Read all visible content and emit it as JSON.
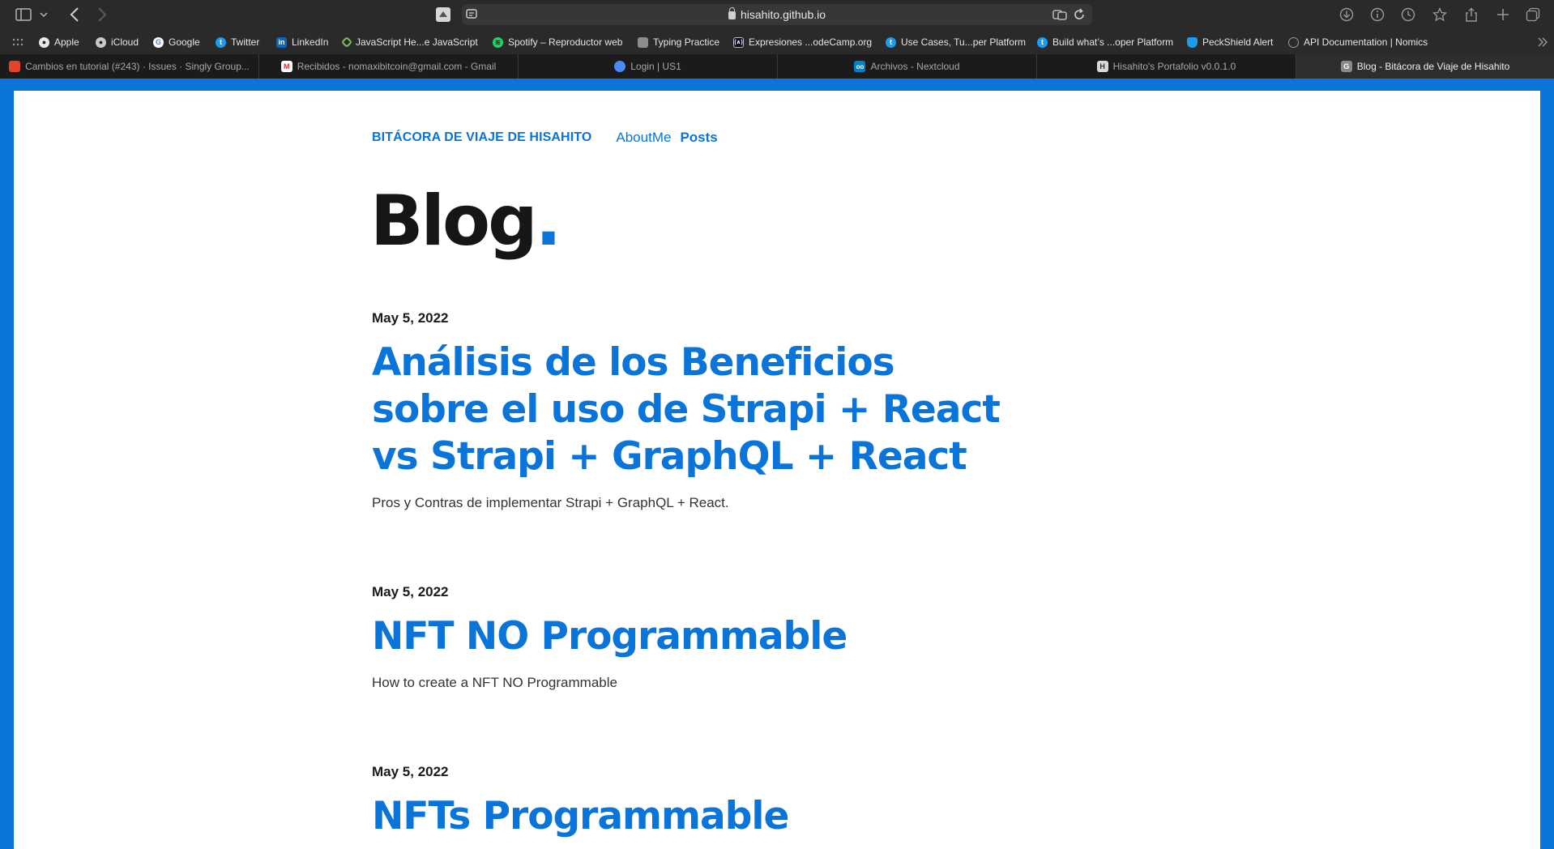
{
  "browser": {
    "url": "hisahito.github.io"
  },
  "bookmarks": [
    {
      "label": "Apple",
      "icon": "apple-icon"
    },
    {
      "label": "iCloud",
      "icon": "apple-icon"
    },
    {
      "label": "Google",
      "icon": "google-icon"
    },
    {
      "label": "Twitter",
      "icon": "twitter-icon"
    },
    {
      "label": "LinkedIn",
      "icon": "linkedin-icon"
    },
    {
      "label": "JavaScript He...e JavaScript",
      "icon": "javascript-icon"
    },
    {
      "label": "Spotify – Reproductor web",
      "icon": "spotify-icon"
    },
    {
      "label": "Typing Practice",
      "icon": "typing-icon"
    },
    {
      "label": "Expresiones ...odeCamp.org",
      "icon": "freecodecamp-icon"
    },
    {
      "label": "Use Cases, Tu...per Platform",
      "icon": "twitter-icon"
    },
    {
      "label": "Build what’s ...oper Platform",
      "icon": "twitter-icon"
    },
    {
      "label": "PeckShield Alert",
      "icon": "shield-icon"
    },
    {
      "label": "API Documentation | Nomics",
      "icon": "globe-icon"
    }
  ],
  "tabs": [
    {
      "label": "Cambios en tutorial (#243) · Issues · Singly Group...",
      "icon": "gitlab-icon"
    },
    {
      "label": "Recibidos - nomaxibitcoin@gmail.com - Gmail",
      "icon": "gmail-icon"
    },
    {
      "label": "Login | US1",
      "icon": "login-icon"
    },
    {
      "label": "Archivos - Nextcloud",
      "icon": "nextcloud-icon"
    },
    {
      "label": "Hisahito's Portafolio v0.0.1.0",
      "icon": "portfolio-icon"
    },
    {
      "label": "Blog - Bitácora de Viaje de Hisahito",
      "icon": "blog-icon"
    }
  ],
  "site": {
    "brand": "BITÁCORA DE VIAJE DE HISAHITO",
    "nav": {
      "aboutme": "AboutMe",
      "posts": "Posts"
    },
    "title": "Blog",
    "title_dot": "."
  },
  "posts": [
    {
      "date": "May 5, 2022",
      "title": "Análisis de los Beneficios sobre el uso de Strapi + React vs Strapi + GraphQL + React",
      "description": "Pros y Contras de implementar Strapi + GraphQL + React."
    },
    {
      "date": "May 5, 2022",
      "title": "NFT NO Programmable",
      "description": "How to create a NFT NO Programmable"
    },
    {
      "date": "May 5, 2022",
      "title": "NFTs Programmable",
      "description": ""
    }
  ],
  "colors": {
    "accent": "#0a74d8",
    "browser_chrome": "#2a2a2a",
    "tab_bar": "#1b1b1b"
  }
}
